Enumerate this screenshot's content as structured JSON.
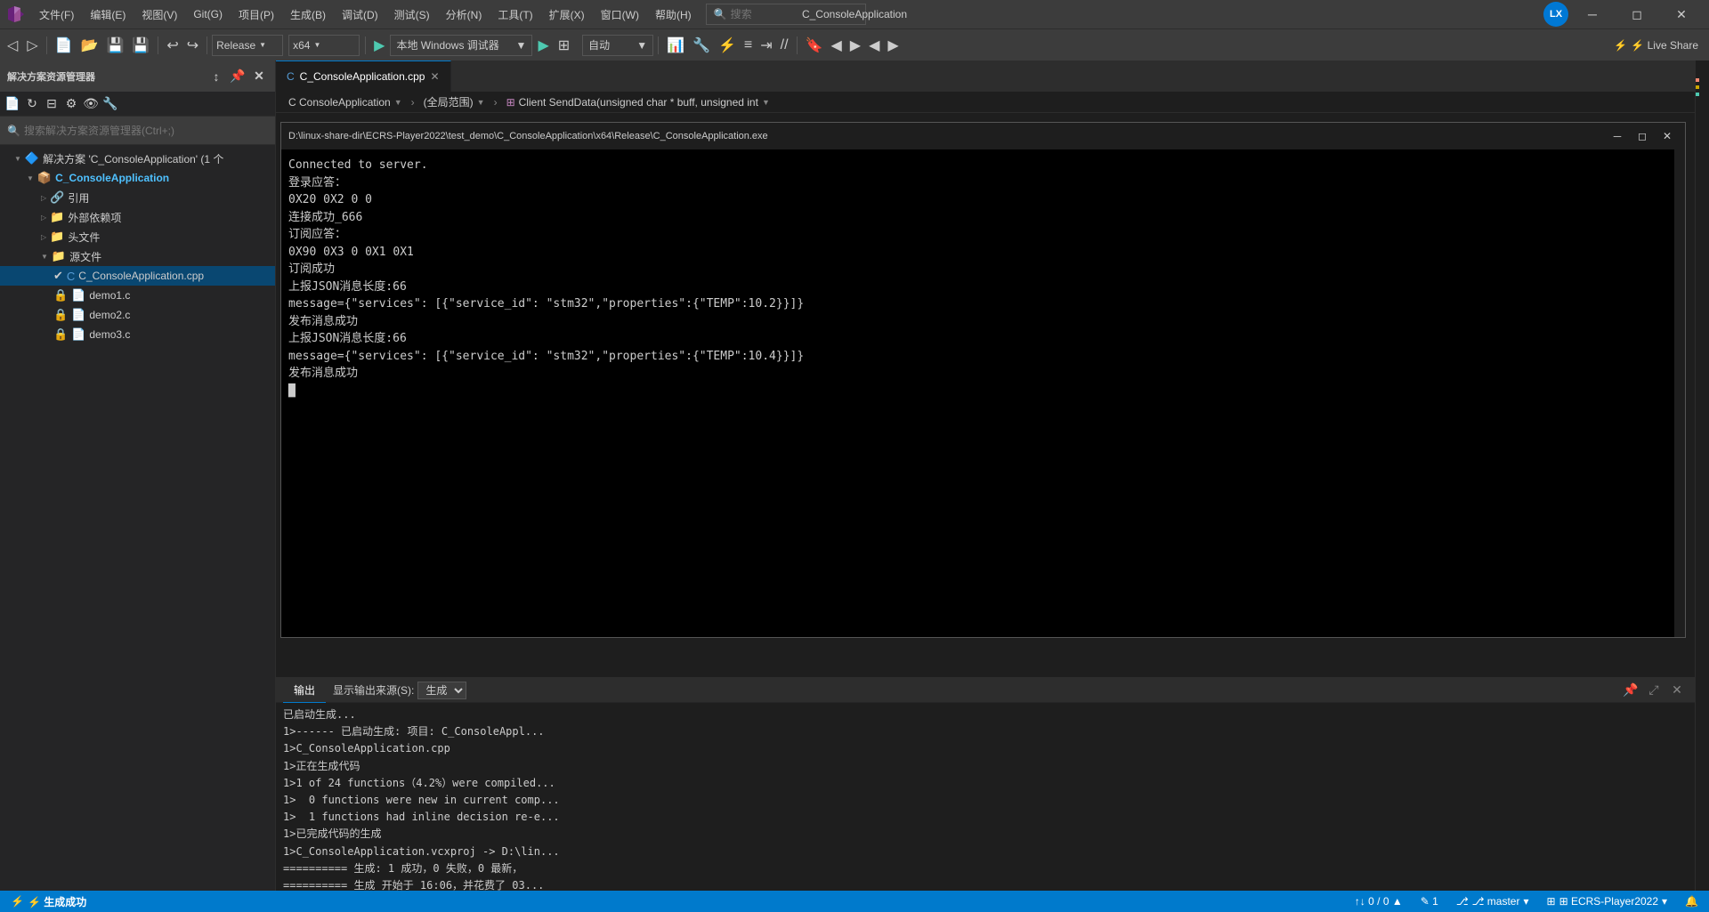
{
  "titlebar": {
    "title": "C_ConsoleApplication",
    "menus": [
      "文件(F)",
      "编辑(E)",
      "视图(V)",
      "Git(G)",
      "项目(P)",
      "生成(B)",
      "调试(D)",
      "测试(S)",
      "分析(N)",
      "工具(T)",
      "扩展(X)",
      "窗口(W)",
      "帮助(H)"
    ],
    "search_placeholder": "搜索",
    "user_initials": "LX",
    "btn_minimize": "─",
    "btn_restore": "◻",
    "btn_close": "✕"
  },
  "toolbar": {
    "build_config": "Release",
    "platform": "x64",
    "debug_target": "本地 Windows 调试器",
    "auto_label": "自动",
    "live_share_label": "⚡ Live Share"
  },
  "sidebar": {
    "header": "解决方案资源管理器",
    "search_placeholder": "搜索解决方案资源管理器(Ctrl+;)",
    "solution_label": "解决方案 'C_ConsoleApplication' (1 个",
    "project_label": "C_ConsoleApplication",
    "tree_items": [
      {
        "label": "引用",
        "indent": 2,
        "icon": "📁",
        "expanded": false
      },
      {
        "label": "外部依赖项",
        "indent": 2,
        "icon": "📁",
        "expanded": false
      },
      {
        "label": "头文件",
        "indent": 2,
        "icon": "📁",
        "expanded": false
      },
      {
        "label": "源文件",
        "indent": 2,
        "icon": "📁",
        "expanded": true
      },
      {
        "label": "C_ConsoleApplication.cpp",
        "indent": 3,
        "icon": "📄"
      },
      {
        "label": "demo1.c",
        "indent": 3,
        "icon": "📄"
      },
      {
        "label": "demo2.c",
        "indent": 3,
        "icon": "📄"
      },
      {
        "label": "demo3.c",
        "indent": 3,
        "icon": "📄"
      }
    ]
  },
  "editor": {
    "tab_label": "C_ConsoleApplication.cpp",
    "breadcrumb_project": "C ConsoleApplication",
    "breadcrumb_scope": "(全局范围)",
    "breadcrumb_func": "Client SendData(unsigned char * buff, unsigned int"
  },
  "console": {
    "title": "D:\\linux-share-dir\\ECRS-Player2022\\test_demo\\C_ConsoleApplication\\x64\\Release\\C_ConsoleApplication.exe",
    "lines": [
      "Connected to server.",
      "登录应答：",
      "0X20 0X2 0 0",
      "连接成功_666",
      "订阅应答：",
      "0X90 0X3 0 0X1 0X1",
      "订阅成功",
      "上报JSON消息长度:66",
      "message={\"services\": [{\"service_id\": \"stm32\",\"properties\":{\"TEMP\":10.2}}]}",
      "发布消息成功",
      "上报JSON消息长度:66",
      "message={\"services\": [{\"service_id\": \"stm32\",\"properties\":{\"TEMP\":10.4}}]}",
      "发布消息成功"
    ]
  },
  "output_panel": {
    "tab_label": "输出",
    "source_label": "显示输出来源(S):",
    "source_value": "生成",
    "lines": [
      "已启动生成...",
      "1>------ 已启动生成: 项目: C_ConsoleAppl...",
      "1>C_ConsoleApplication.cpp",
      "1>正在生成代码",
      "1>1 of 24 functions（4.2%）were compiled...",
      "1>  0 functions were new in current comp...",
      "1>  1 functions had inline decision re-e...",
      "1>已完成代码的生成",
      "1>C_ConsoleApplication.vcxproj -> D:\\lin...",
      "========== 生成: 1 成功，0 失败，0 最新，",
      "========== 生成 开始于 16:06，并花费了 03..."
    ]
  },
  "statusbar": {
    "success_label": "⚡ 生成成功",
    "errors": "↑↓ 0 / 0 ▲",
    "line_col": "✎ 1",
    "branch": "⎇ master",
    "branch_arrow": "▾",
    "repo": "⊞ ECRS-Player2022",
    "repo_arrow": "▾",
    "notifications": "🔔"
  }
}
